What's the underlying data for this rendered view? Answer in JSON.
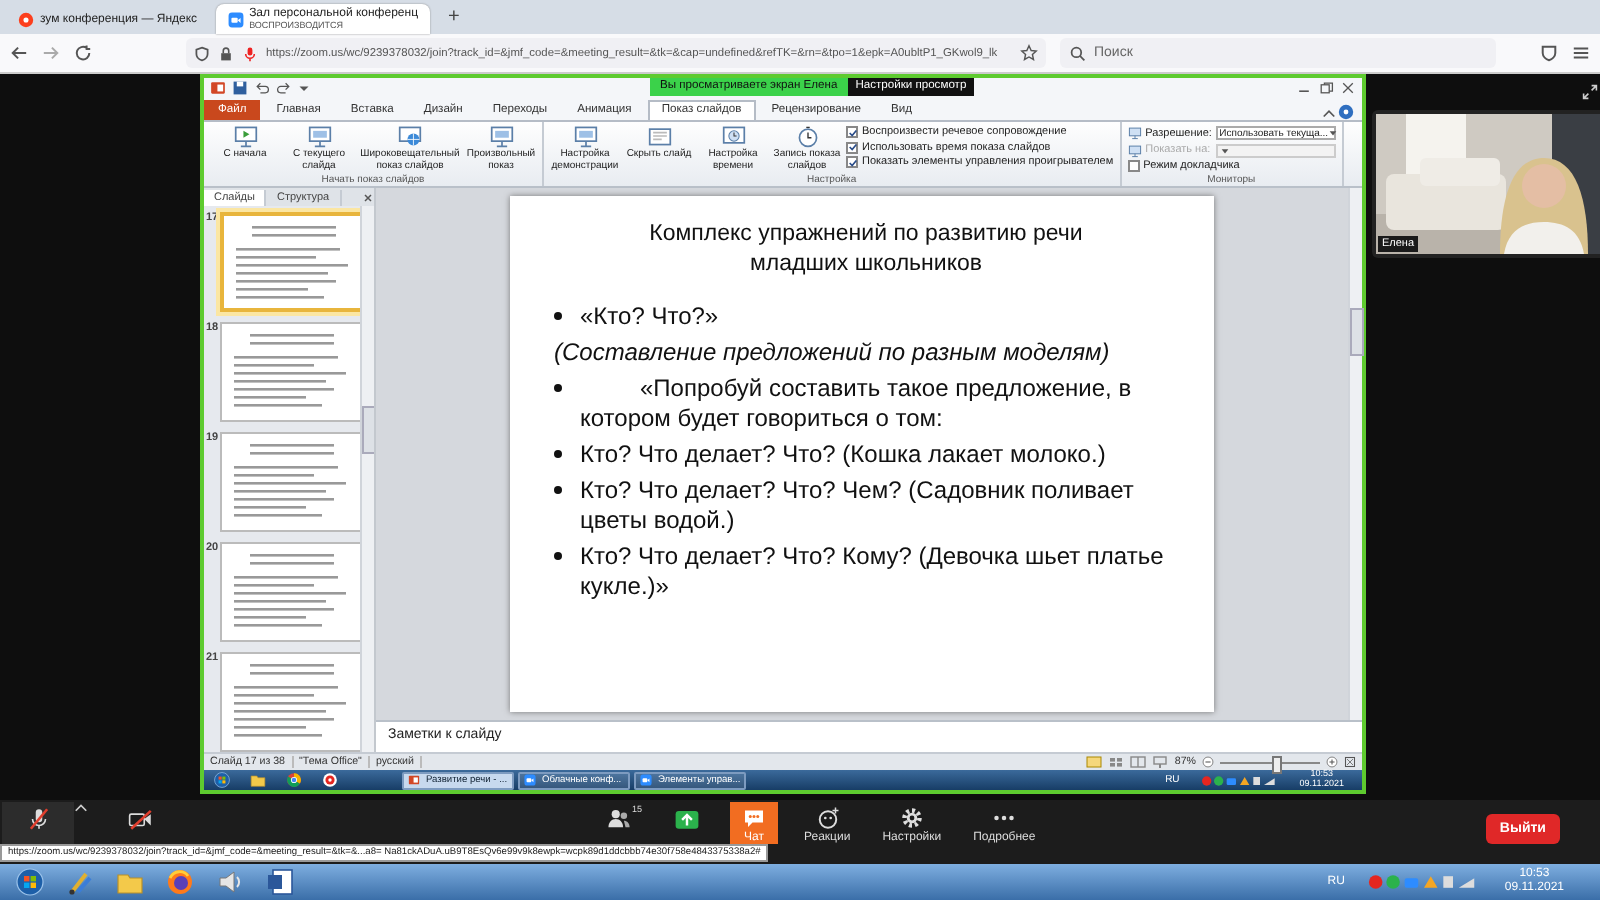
{
  "browser": {
    "tabs": [
      {
        "title": "зум конференция — Яндекс",
        "kind": "search",
        "selected": false
      },
      {
        "title": "Зал персональной конференц",
        "subtitle": "ВОСПРОИЗВОДИТСЯ",
        "kind": "meeting",
        "selected": true
      }
    ],
    "new_tab": "+",
    "url": "https://zoom.us/wc/9239378032/join?track_id=&jmf_code=&meeting_result=&tk=&cap=undefined&refTK=&rn=&tpo=1&epk=A0ubltP1_GKwol9_lk",
    "search": {
      "placeholder": "Поиск"
    }
  },
  "share_banner": {
    "text": "Вы просматриваете экран Елена",
    "settings": "Настройки просмотр"
  },
  "powerpoint": {
    "ribbon_tabs": [
      {
        "label": "Файл",
        "kind": "file",
        "selected": false
      },
      {
        "label": "Главная",
        "kind": "tab",
        "selected": false
      },
      {
        "label": "Вставка",
        "kind": "tab",
        "selected": false
      },
      {
        "label": "Дизайн",
        "kind": "tab",
        "selected": false
      },
      {
        "label": "Переходы",
        "kind": "tab",
        "selected": false
      },
      {
        "label": "Анимация",
        "kind": "tab",
        "selected": false
      },
      {
        "label": "Показ слайдов",
        "kind": "tab",
        "selected": true
      },
      {
        "label": "Рецензирование",
        "kind": "tab",
        "selected": false
      },
      {
        "label": "Вид",
        "kind": "tab",
        "selected": false
      }
    ],
    "groups": [
      {
        "label": "Начать показ слайдов",
        "buttons": [
          {
            "label": "С начала",
            "kind": "play"
          },
          {
            "label": "С текущего слайда",
            "kind": "screen"
          },
          {
            "label": "Широковещательный показ слайдов",
            "kind": "globe"
          },
          {
            "label": "Произвольный показ",
            "kind": "screen"
          }
        ]
      },
      {
        "label": "Настройка",
        "buttons": [
          {
            "label": "Настройка демонстрации",
            "kind": "screen"
          },
          {
            "label": "Скрыть слайд",
            "kind": "hide"
          },
          {
            "label": "Настройка времени",
            "kind": "timing"
          },
          {
            "label": "Запись показа слайдов",
            "kind": "record"
          }
        ],
        "checkboxes": [
          {
            "label": "Воспроизвести речевое сопровождение",
            "checked": true
          },
          {
            "label": "Использовать время показа слайдов",
            "checked": true
          },
          {
            "label": "Показать элементы управления проигрывателем",
            "checked": true
          }
        ]
      },
      {
        "label": "Мониторы",
        "fields": [
          {
            "label": "Разрешение:",
            "value": "Использовать текуща...",
            "disabled": false
          },
          {
            "label": "Показать на:",
            "disabled": true
          }
        ],
        "checkboxes": [
          {
            "label": "Режим докладчика",
            "checked": false
          }
        ]
      }
    ],
    "pane_tabs": [
      {
        "label": "Слайды",
        "selected": true
      },
      {
        "label": "Структура",
        "selected": false
      }
    ],
    "thumbnails": [
      {
        "number": "17",
        "selected": true
      },
      {
        "number": "18",
        "selected": false
      },
      {
        "number": "19",
        "selected": false
      },
      {
        "number": "20",
        "selected": false
      },
      {
        "number": "21",
        "selected": false
      }
    ],
    "slide": {
      "title": "Комплекс упражнений по развитию речи младших школьников",
      "items": [
        {
          "kind": "bullet",
          "text": "«Кто? Что?»"
        },
        {
          "kind": "note",
          "text": "(Составление предложений по разным моделям)"
        },
        {
          "kind": "indented",
          "text": "«Попробуй составить такое предложение, в котором будет говориться о том:"
        },
        {
          "kind": "bullet",
          "text": "Кто? Что делает? Что? (Кошка лакает молоко.)"
        },
        {
          "kind": "bullet",
          "text": "Кто? Что делает? Что? Чем? (Садовник поливает цветы водой.)"
        },
        {
          "kind": "bullet",
          "text": "Кто? Что делает? Что? Кому? (Девочка шьет платье кукле.)»"
        }
      ]
    },
    "notes": {
      "placeholder": "Заметки к слайду"
    },
    "status": {
      "slide": "Слайд 17 из 38",
      "theme": "\"Тема Office\"",
      "language": "русский",
      "zoom": "87%",
      "zoom_slider": {
        "level": 0.55
      }
    },
    "taskbar": {
      "tasks": [
        {
          "label": "Развитие речи - ...",
          "kind": "presentation",
          "selected": true
        },
        {
          "label": "Облачные конф...",
          "kind": "meeting",
          "selected": false
        },
        {
          "label": "Элементы управ...",
          "kind": "meeting",
          "selected": false
        }
      ],
      "language": "RU",
      "time": "10:53",
      "date": "09.11.2021"
    }
  },
  "video": {
    "name": "Елена"
  },
  "zoom_toolbar": {
    "items": [
      {
        "kind": "mic",
        "muted": true
      },
      {
        "kind": "video",
        "muted": true
      },
      {
        "kind": "participants",
        "count": "15"
      },
      {
        "kind": "share"
      },
      {
        "kind": "chat",
        "label": "Чат",
        "selected": true
      },
      {
        "kind": "reactions",
        "label": "Реакции",
        "selected": false
      },
      {
        "kind": "settings",
        "label": "Настройки",
        "selected": false
      },
      {
        "kind": "more",
        "label": "Подробнее",
        "selected": false
      }
    ],
    "leave": "Выйти",
    "status_url": "https://zoom.us/wc/9239378032/join?track_id=&jmf_code=&meeting_result=&tk=&...a8=   Na81ckADuA.uB9T8EsQv6e99v9k8ewpk=wcpk89d1ddcbbb74e30f758e4843375338a2#"
  },
  "desktop_taskbar": {
    "language": "RU",
    "time": "10:53",
    "date": "09.11.2021"
  }
}
